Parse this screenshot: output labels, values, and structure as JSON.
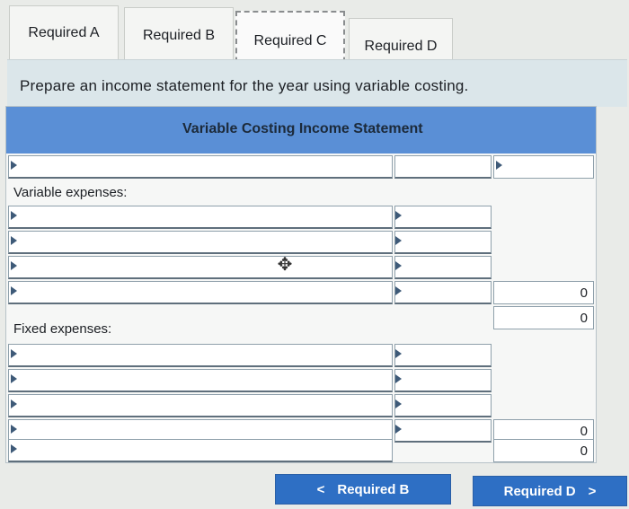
{
  "tabs": [
    {
      "label": "Required A",
      "active": false
    },
    {
      "label": "Required B",
      "active": false
    },
    {
      "label": "Required C",
      "active": true
    },
    {
      "label": "Required D",
      "active": false
    }
  ],
  "instruction": "Prepare an income statement for the year using variable costing.",
  "statement": {
    "title": "Variable Costing Income Statement",
    "rows": [
      {
        "label": "",
        "mid": "",
        "right": ""
      },
      {
        "label": "Variable expenses:",
        "mid": "",
        "right": ""
      },
      {
        "label": "",
        "mid": "",
        "right": ""
      },
      {
        "label": "",
        "mid": "",
        "right": ""
      },
      {
        "label": "",
        "mid": "",
        "right": ""
      },
      {
        "label": "",
        "mid": "",
        "right": "0"
      },
      {
        "label": "",
        "mid": "",
        "right": "0"
      },
      {
        "label": "Fixed expenses:",
        "mid": "",
        "right": ""
      },
      {
        "label": "",
        "mid": "",
        "right": ""
      },
      {
        "label": "",
        "mid": "",
        "right": ""
      },
      {
        "label": "",
        "mid": "",
        "right": ""
      },
      {
        "label": "",
        "mid": "",
        "right": "0"
      },
      {
        "label": "",
        "mid": "",
        "right": "0"
      }
    ]
  },
  "nav": {
    "prev_label": "Required B",
    "prev_icon": "<",
    "next_label": "Required D",
    "next_icon": ">"
  },
  "colors": {
    "header": "#5a8fd6",
    "button": "#2e6fc4"
  }
}
